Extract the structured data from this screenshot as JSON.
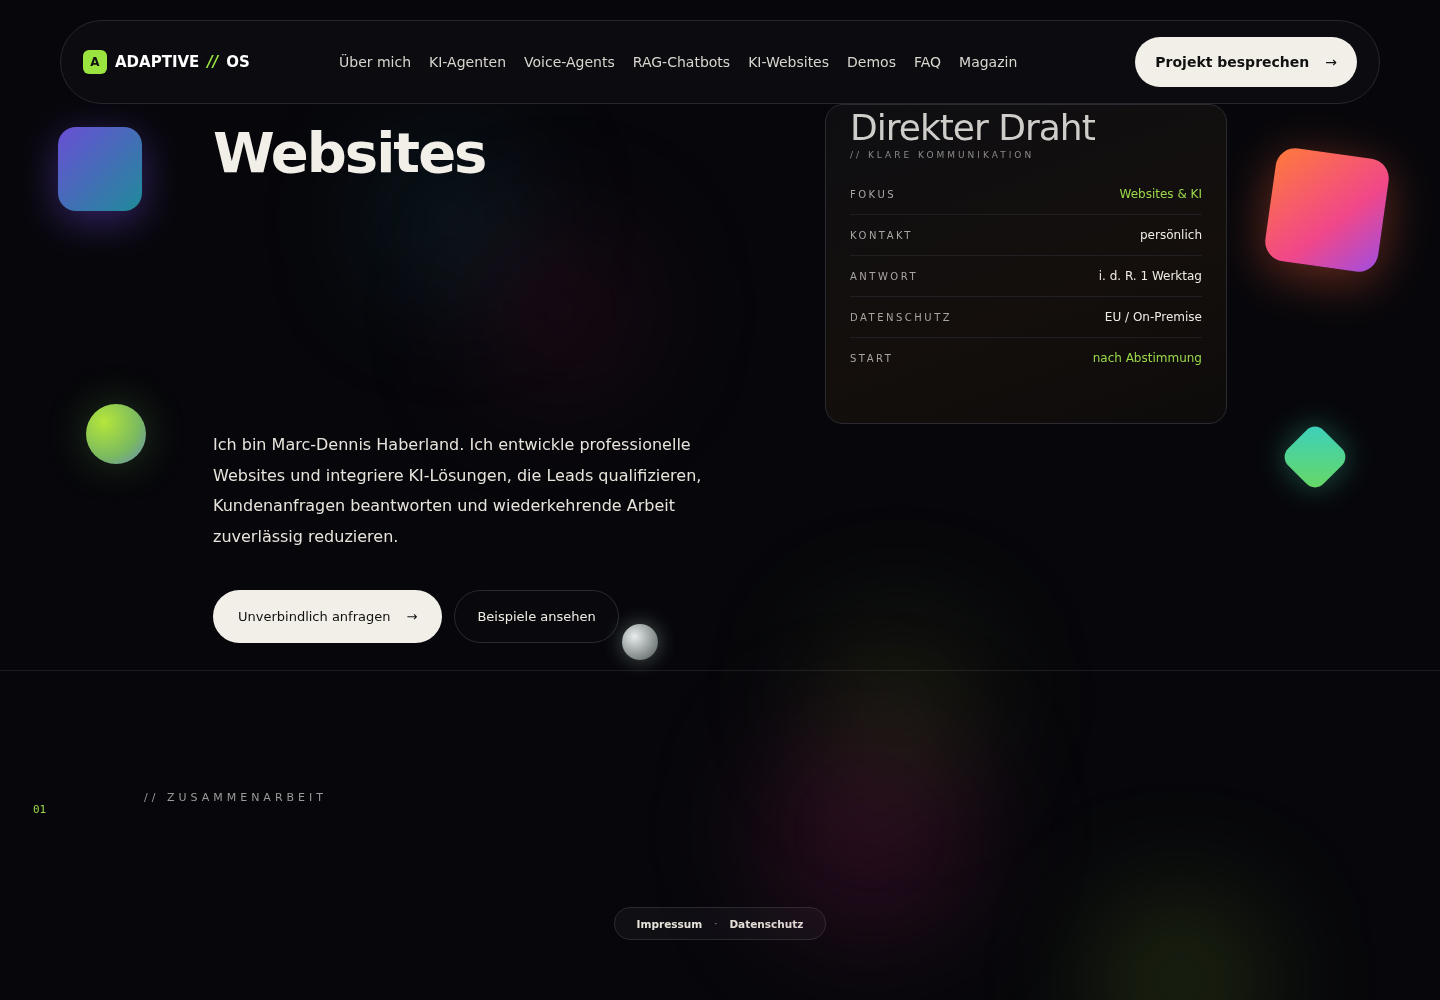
{
  "brand": {
    "mark": "A",
    "name": "ADAPTIVE",
    "separator": "//",
    "suffix": "OS"
  },
  "nav": [
    "Über mich",
    "KI-Agenten",
    "Voice-Agents",
    "RAG-Chatbots",
    "KI-Websites",
    "Demos",
    "FAQ",
    "Magazin"
  ],
  "nav_cta": {
    "label": "Projekt besprechen",
    "arrow": "→"
  },
  "hero": {
    "title": "Websites",
    "intro": "Ich bin Marc-Dennis Haberland. Ich entwickle professionelle Websites und integriere KI-Lösungen, die Leads qualifizieren, Kundenanfragen beantworten und wiederkehrende Arbeit zuverlässig reduzieren.",
    "primary_button": {
      "label": "Unverbindlich anfragen",
      "arrow": "→"
    },
    "secondary_button": {
      "label": "Beispiele ansehen"
    }
  },
  "card": {
    "title": "Direkter Draht",
    "subtitle": "// KLARE KOMMUNIKATION",
    "rows": [
      {
        "label": "FOKUS",
        "value": "Websites & KI",
        "color": "#9bd84a"
      },
      {
        "label": "KONTAKT",
        "value": "persönlich",
        "color": "#f0ece4"
      },
      {
        "label": "ANTWORT",
        "value": "i. d. R. 1 Werktag",
        "color": "#f0ece4"
      },
      {
        "label": "DATENSCHUTZ",
        "value": "EU / On-Premise",
        "color": "#f0ece4"
      },
      {
        "label": "START",
        "value": "nach Abstimmung",
        "color": "#9bd84a"
      }
    ]
  },
  "section": {
    "number": "01",
    "label": "// ZUSAMMENARBEIT"
  },
  "footer": {
    "links": [
      "Impressum",
      "Datenschutz"
    ],
    "separator": "·"
  }
}
